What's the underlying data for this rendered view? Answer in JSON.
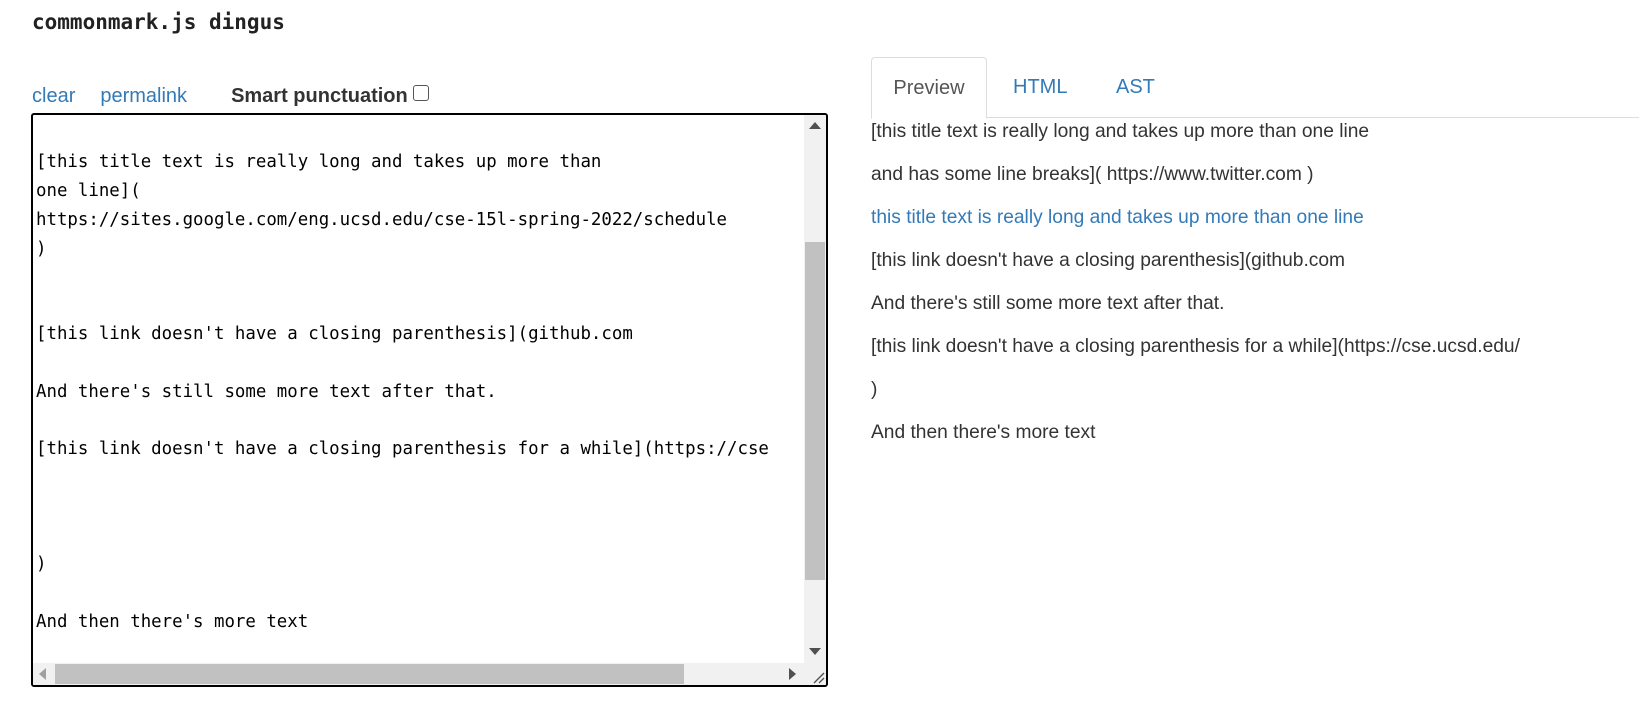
{
  "app": {
    "title": "commonmark.js dingus"
  },
  "toolbar": {
    "clear_label": "clear",
    "permalink_label": "permalink",
    "smart_punctuation_label": "Smart punctuation",
    "smart_punctuation_checked": false
  },
  "editor": {
    "lines": [
      "[this title text is really long and takes up more than",
      "one line](",
      "https://sites.google.com/eng.ucsd.edu/cse-15l-spring-2022/schedule",
      ")",
      "[this link doesn't have a closing parenthesis](github.com",
      "And there's still some more text after that.",
      "[this link doesn't have a closing parenthesis for a while](https://cse",
      ")",
      "And then there's more text"
    ]
  },
  "tabs": {
    "preview": "Preview",
    "html": "HTML",
    "ast": "AST",
    "active": "Preview"
  },
  "preview": {
    "lines": [
      {
        "text": "[this title text is really long and takes up more than one line",
        "kind": "text"
      },
      {
        "text": "and has some line breaks]( https://www.twitter.com )",
        "kind": "text"
      },
      {
        "text": "this title text is really long and takes up more than one line",
        "kind": "link"
      },
      {
        "text": "[this link doesn't have a closing parenthesis](github.com",
        "kind": "text"
      },
      {
        "text": "And there's still some more text after that.",
        "kind": "text"
      },
      {
        "text": "[this link doesn't have a closing parenthesis for a while](https://cse.ucsd.edu/",
        "kind": "text"
      },
      {
        "text": ")",
        "kind": "text"
      },
      {
        "text": "And then there's more text",
        "kind": "text"
      }
    ]
  },
  "colors": {
    "link": "#337ab7",
    "text": "#333333",
    "editor_border": "#000000",
    "scrollbar_track": "#f1f1f1",
    "scrollbar_thumb": "#c1c1c1"
  }
}
